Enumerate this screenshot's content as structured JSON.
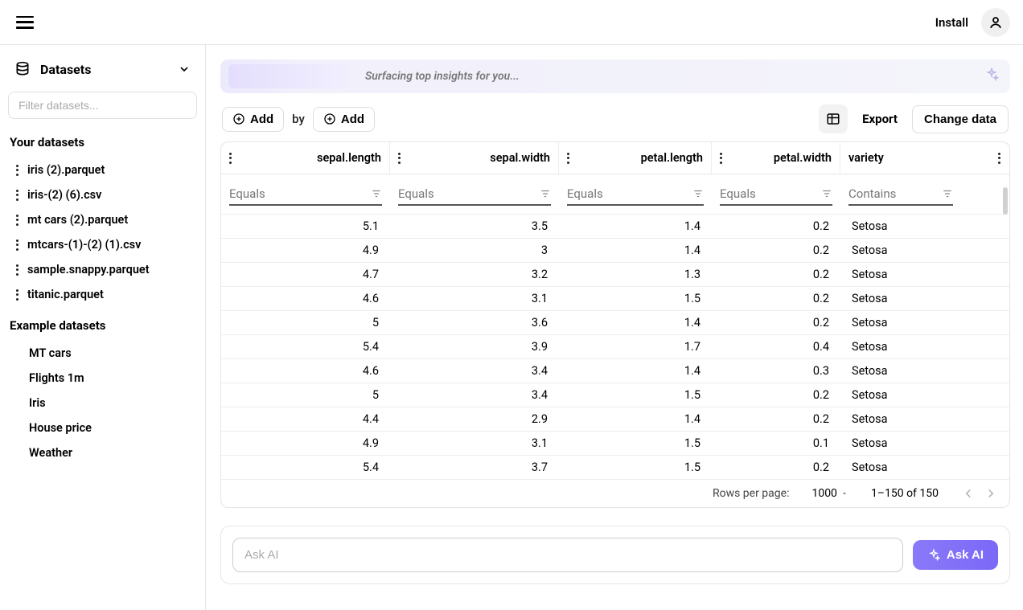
{
  "topbar": {
    "install": "Install"
  },
  "sidebar": {
    "title": "Datasets",
    "filter_placeholder": "Filter datasets...",
    "your_label": "Your datasets",
    "your_items": [
      "iris (2).parquet",
      "iris-(2) (6).csv",
      "mt cars (2).parquet",
      "mtcars-(1)-(2) (1).csv",
      "sample.snappy.parquet",
      "titanic.parquet"
    ],
    "example_label": "Example datasets",
    "example_items": [
      "MT cars",
      "Flights 1m",
      "Iris",
      "House price",
      "Weather"
    ]
  },
  "banner": {
    "text": "Surfacing top insights for you..."
  },
  "toolbar": {
    "add1": "Add",
    "by": "by",
    "add2": "Add",
    "export": "Export",
    "change": "Change data"
  },
  "columns": [
    "sepal.length",
    "sepal.width",
    "petal.length",
    "petal.width",
    "variety"
  ],
  "filters": {
    "equals": "Equals",
    "contains": "Contains"
  },
  "rows": [
    {
      "sl": "5.1",
      "sw": "3.5",
      "pl": "1.4",
      "pw": "0.2",
      "v": "Setosa"
    },
    {
      "sl": "4.9",
      "sw": "3",
      "pl": "1.4",
      "pw": "0.2",
      "v": "Setosa"
    },
    {
      "sl": "4.7",
      "sw": "3.2",
      "pl": "1.3",
      "pw": "0.2",
      "v": "Setosa"
    },
    {
      "sl": "4.6",
      "sw": "3.1",
      "pl": "1.5",
      "pw": "0.2",
      "v": "Setosa"
    },
    {
      "sl": "5",
      "sw": "3.6",
      "pl": "1.4",
      "pw": "0.2",
      "v": "Setosa"
    },
    {
      "sl": "5.4",
      "sw": "3.9",
      "pl": "1.7",
      "pw": "0.4",
      "v": "Setosa"
    },
    {
      "sl": "4.6",
      "sw": "3.4",
      "pl": "1.4",
      "pw": "0.3",
      "v": "Setosa"
    },
    {
      "sl": "5",
      "sw": "3.4",
      "pl": "1.5",
      "pw": "0.2",
      "v": "Setosa"
    },
    {
      "sl": "4.4",
      "sw": "2.9",
      "pl": "1.4",
      "pw": "0.2",
      "v": "Setosa"
    },
    {
      "sl": "4.9",
      "sw": "3.1",
      "pl": "1.5",
      "pw": "0.1",
      "v": "Setosa"
    },
    {
      "sl": "5.4",
      "sw": "3.7",
      "pl": "1.5",
      "pw": "0.2",
      "v": "Setosa"
    }
  ],
  "pager": {
    "rpp_label": "Rows per page:",
    "rpp_value": "1000",
    "range": "1–150 of 150"
  },
  "ask": {
    "placeholder": "Ask AI",
    "button": "Ask AI"
  }
}
